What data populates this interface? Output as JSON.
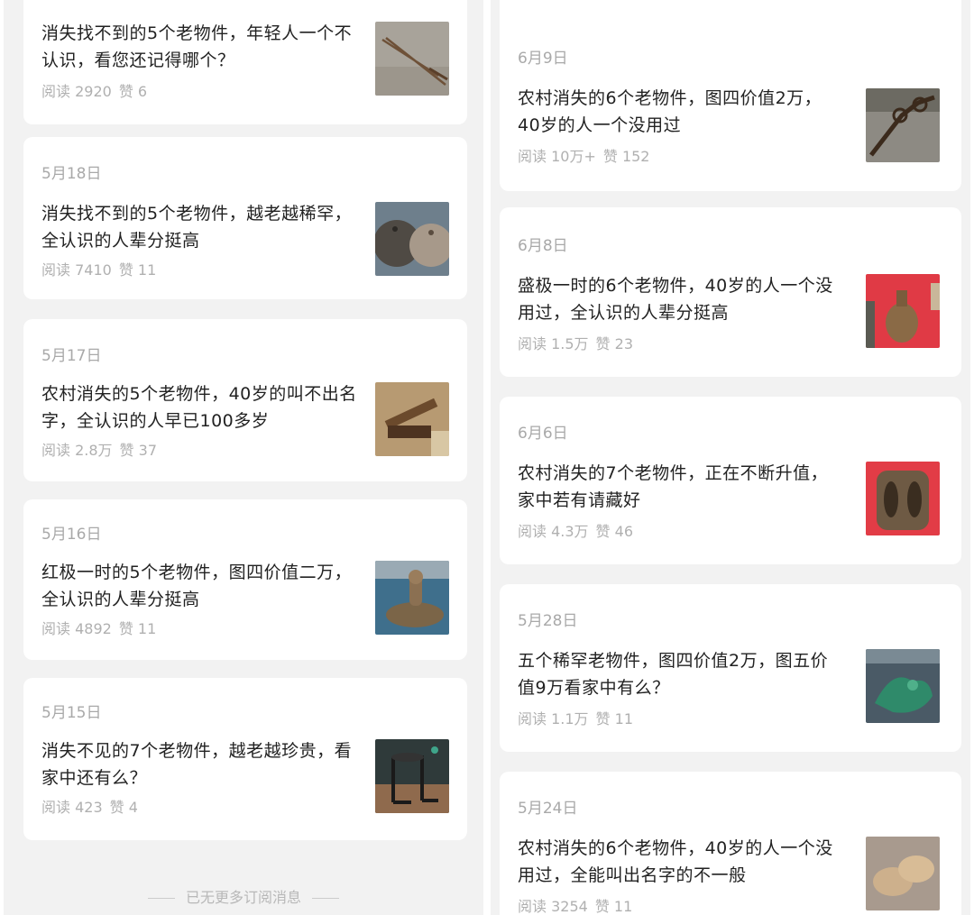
{
  "left_column": {
    "articles": [
      {
        "date": "",
        "title": "消失找不到的5个老物件，年轻人一个不认识，看您还记得哪个？",
        "reads": "阅读 2920",
        "likes": "赞 6",
        "thumb": "rusty-tongs-thumb"
      },
      {
        "date": "5月18日",
        "title": "消失找不到的5个老物件，越老越稀罕，全认识的人辈分挺高",
        "reads": "阅读 7410",
        "likes": "赞 11",
        "thumb": "stone-balls-thumb"
      },
      {
        "date": "5月17日",
        "title": "农村消失的5个老物件，40岁的叫不出名字，全认识的人早已100多岁",
        "reads": "阅读 2.8万",
        "likes": "赞 37",
        "thumb": "wooden-tool-thumb"
      },
      {
        "date": "5月16日",
        "title": "红极一时的5个老物件，图四价值二万，全认识的人辈分挺高",
        "reads": "阅读 4892",
        "likes": "赞 11",
        "thumb": "stone-mortar-thumb"
      },
      {
        "date": "5月15日",
        "title": "消失不见的7个老物件，越老越珍贵，看家中还有么？",
        "reads": "阅读 423",
        "likes": "赞 4",
        "thumb": "iron-stand-thumb"
      }
    ],
    "footer_note": "已无更多订阅消息"
  },
  "right_column": {
    "articles": [
      {
        "date": "6月9日",
        "title": "农村消失的6个老物件，图四价值2万，40岁的人一个没用过",
        "reads": "阅读 10万+",
        "likes": "赞 152",
        "thumb": "iron-chain-thumb"
      },
      {
        "date": "6月8日",
        "title": "盛极一时的6个老物件，40岁的人一个没用过，全认识的人辈分挺高",
        "reads": "阅读 1.5万",
        "likes": "赞 23",
        "thumb": "bronze-pot-thumb"
      },
      {
        "date": "6月6日",
        "title": "农村消失的7个老物件，正在不断升值，家中若有请藏好",
        "reads": "阅读 4.3万",
        "likes": "赞 46",
        "thumb": "iron-mold-thumb"
      },
      {
        "date": "5月28日",
        "title": "五个稀罕老物件，图四价值2万，图五价值9万看家中有么？",
        "reads": "阅读 1.1万",
        "likes": "赞 11",
        "thumb": "jade-carving-thumb"
      },
      {
        "date": "5月24日",
        "title": "农村消失的6个老物件，40岁的人一个没用过，全能叫出名字的不一般",
        "reads": "阅读 3254",
        "likes": "赞 11",
        "thumb": "clay-discs-thumb"
      }
    ]
  },
  "colors": {
    "accent": "#07c160",
    "background": "#f2f2f2",
    "card": "#ffffff",
    "meta_text": "#b0b0b0"
  }
}
